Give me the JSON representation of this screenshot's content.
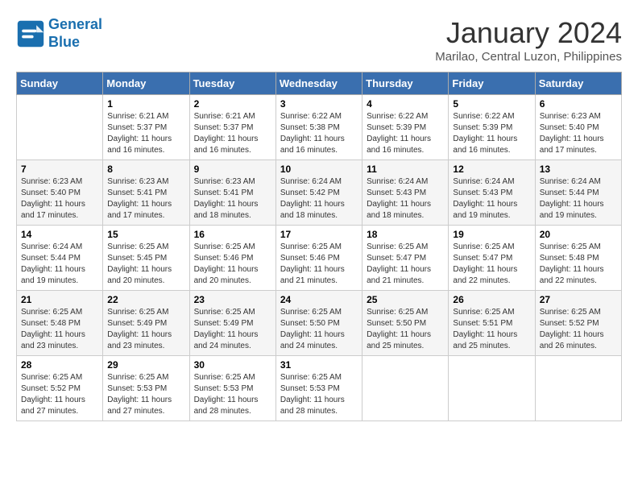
{
  "header": {
    "logo_line1": "General",
    "logo_line2": "Blue",
    "month_year": "January 2024",
    "location": "Marilao, Central Luzon, Philippines"
  },
  "days_of_week": [
    "Sunday",
    "Monday",
    "Tuesday",
    "Wednesday",
    "Thursday",
    "Friday",
    "Saturday"
  ],
  "weeks": [
    [
      {
        "num": "",
        "info": ""
      },
      {
        "num": "1",
        "info": "Sunrise: 6:21 AM\nSunset: 5:37 PM\nDaylight: 11 hours\nand 16 minutes."
      },
      {
        "num": "2",
        "info": "Sunrise: 6:21 AM\nSunset: 5:37 PM\nDaylight: 11 hours\nand 16 minutes."
      },
      {
        "num": "3",
        "info": "Sunrise: 6:22 AM\nSunset: 5:38 PM\nDaylight: 11 hours\nand 16 minutes."
      },
      {
        "num": "4",
        "info": "Sunrise: 6:22 AM\nSunset: 5:39 PM\nDaylight: 11 hours\nand 16 minutes."
      },
      {
        "num": "5",
        "info": "Sunrise: 6:22 AM\nSunset: 5:39 PM\nDaylight: 11 hours\nand 16 minutes."
      },
      {
        "num": "6",
        "info": "Sunrise: 6:23 AM\nSunset: 5:40 PM\nDaylight: 11 hours\nand 17 minutes."
      }
    ],
    [
      {
        "num": "7",
        "info": "Sunrise: 6:23 AM\nSunset: 5:40 PM\nDaylight: 11 hours\nand 17 minutes."
      },
      {
        "num": "8",
        "info": "Sunrise: 6:23 AM\nSunset: 5:41 PM\nDaylight: 11 hours\nand 17 minutes."
      },
      {
        "num": "9",
        "info": "Sunrise: 6:23 AM\nSunset: 5:41 PM\nDaylight: 11 hours\nand 18 minutes."
      },
      {
        "num": "10",
        "info": "Sunrise: 6:24 AM\nSunset: 5:42 PM\nDaylight: 11 hours\nand 18 minutes."
      },
      {
        "num": "11",
        "info": "Sunrise: 6:24 AM\nSunset: 5:43 PM\nDaylight: 11 hours\nand 18 minutes."
      },
      {
        "num": "12",
        "info": "Sunrise: 6:24 AM\nSunset: 5:43 PM\nDaylight: 11 hours\nand 19 minutes."
      },
      {
        "num": "13",
        "info": "Sunrise: 6:24 AM\nSunset: 5:44 PM\nDaylight: 11 hours\nand 19 minutes."
      }
    ],
    [
      {
        "num": "14",
        "info": "Sunrise: 6:24 AM\nSunset: 5:44 PM\nDaylight: 11 hours\nand 19 minutes."
      },
      {
        "num": "15",
        "info": "Sunrise: 6:25 AM\nSunset: 5:45 PM\nDaylight: 11 hours\nand 20 minutes."
      },
      {
        "num": "16",
        "info": "Sunrise: 6:25 AM\nSunset: 5:46 PM\nDaylight: 11 hours\nand 20 minutes."
      },
      {
        "num": "17",
        "info": "Sunrise: 6:25 AM\nSunset: 5:46 PM\nDaylight: 11 hours\nand 21 minutes."
      },
      {
        "num": "18",
        "info": "Sunrise: 6:25 AM\nSunset: 5:47 PM\nDaylight: 11 hours\nand 21 minutes."
      },
      {
        "num": "19",
        "info": "Sunrise: 6:25 AM\nSunset: 5:47 PM\nDaylight: 11 hours\nand 22 minutes."
      },
      {
        "num": "20",
        "info": "Sunrise: 6:25 AM\nSunset: 5:48 PM\nDaylight: 11 hours\nand 22 minutes."
      }
    ],
    [
      {
        "num": "21",
        "info": "Sunrise: 6:25 AM\nSunset: 5:48 PM\nDaylight: 11 hours\nand 23 minutes."
      },
      {
        "num": "22",
        "info": "Sunrise: 6:25 AM\nSunset: 5:49 PM\nDaylight: 11 hours\nand 23 minutes."
      },
      {
        "num": "23",
        "info": "Sunrise: 6:25 AM\nSunset: 5:49 PM\nDaylight: 11 hours\nand 24 minutes."
      },
      {
        "num": "24",
        "info": "Sunrise: 6:25 AM\nSunset: 5:50 PM\nDaylight: 11 hours\nand 24 minutes."
      },
      {
        "num": "25",
        "info": "Sunrise: 6:25 AM\nSunset: 5:50 PM\nDaylight: 11 hours\nand 25 minutes."
      },
      {
        "num": "26",
        "info": "Sunrise: 6:25 AM\nSunset: 5:51 PM\nDaylight: 11 hours\nand 25 minutes."
      },
      {
        "num": "27",
        "info": "Sunrise: 6:25 AM\nSunset: 5:52 PM\nDaylight: 11 hours\nand 26 minutes."
      }
    ],
    [
      {
        "num": "28",
        "info": "Sunrise: 6:25 AM\nSunset: 5:52 PM\nDaylight: 11 hours\nand 27 minutes."
      },
      {
        "num": "29",
        "info": "Sunrise: 6:25 AM\nSunset: 5:53 PM\nDaylight: 11 hours\nand 27 minutes."
      },
      {
        "num": "30",
        "info": "Sunrise: 6:25 AM\nSunset: 5:53 PM\nDaylight: 11 hours\nand 28 minutes."
      },
      {
        "num": "31",
        "info": "Sunrise: 6:25 AM\nSunset: 5:53 PM\nDaylight: 11 hours\nand 28 minutes."
      },
      {
        "num": "",
        "info": ""
      },
      {
        "num": "",
        "info": ""
      },
      {
        "num": "",
        "info": ""
      }
    ]
  ]
}
